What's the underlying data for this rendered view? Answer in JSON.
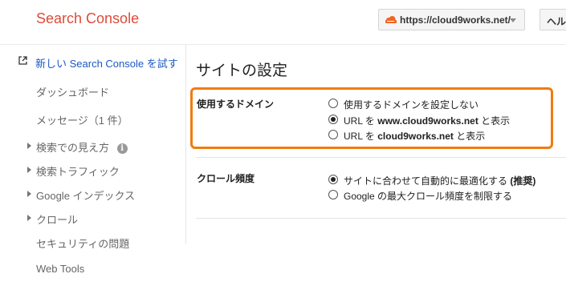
{
  "header": {
    "logo": "Search Console",
    "site": "https://cloud9works.net/",
    "help": "ヘルプ"
  },
  "sidebar": {
    "new_console": "新しい Search Console を試す",
    "items": [
      {
        "label": "ダッシュボード",
        "expandable": false
      },
      {
        "label": "メッセージ（1 件）",
        "expandable": false
      },
      {
        "label": "検索での見え方",
        "expandable": true
      },
      {
        "label": "検索トラフィック",
        "expandable": true
      },
      {
        "label": "Google インデックス",
        "expandable": true
      },
      {
        "label": "クロール",
        "expandable": true
      },
      {
        "label": "セキュリティの問題",
        "expandable": false
      },
      {
        "label": "Web Tools",
        "expandable": false
      }
    ],
    "info_glyph": "i"
  },
  "main": {
    "title": "サイトの設定",
    "preferred_domain": {
      "label": "使用するドメイン",
      "options": [
        {
          "text_parts": [
            "使用するドメインを設定しない"
          ],
          "selected": false
        },
        {
          "text_parts": [
            "URL を ",
            "www.cloud9works.net",
            " と表示"
          ],
          "selected": true
        },
        {
          "text_parts": [
            "URL を ",
            "cloud9works.net",
            " と表示"
          ],
          "selected": false
        }
      ]
    },
    "crawl_rate": {
      "label": "クロール頻度",
      "options": [
        {
          "text_parts": [
            "サイトに合わせて自動的に最適化する ",
            "(推奨)"
          ],
          "selected": true
        },
        {
          "text_parts": [
            "Google の最大クロール頻度を制限する"
          ],
          "selected": false
        }
      ]
    }
  },
  "colors": {
    "logo": "#dd4b39",
    "link": "#1a59c4",
    "highlight_border": "#f07b11"
  }
}
